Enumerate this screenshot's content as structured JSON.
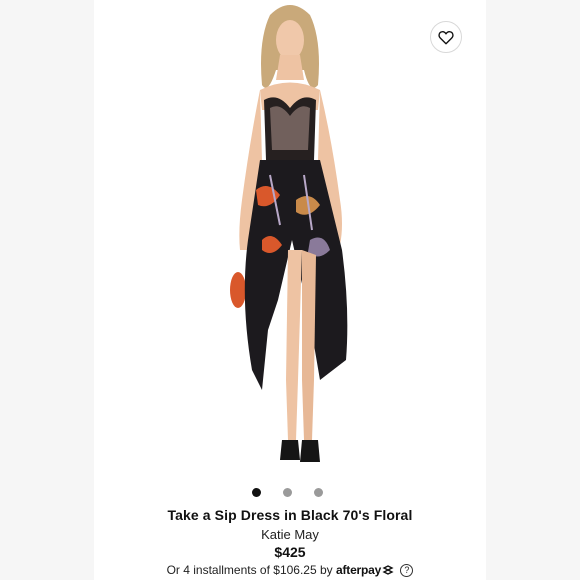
{
  "product": {
    "title": "Take a Sip Dress in Black 70's Floral",
    "brand": "Katie May",
    "price": "$425"
  },
  "installments": {
    "text": "Or 4 installments of $106.25 by",
    "provider": "afterpay",
    "info_icon": "?"
  },
  "icons": {
    "wishlist": "heart-icon",
    "afterpay_mark": "afterpay-arrows-icon",
    "info": "question-circle-icon"
  },
  "carousel": {
    "total": 3,
    "active_index": 0
  },
  "colors": {
    "background": "#ffffff",
    "text": "#111111",
    "accent_orange": "#d9582b"
  }
}
